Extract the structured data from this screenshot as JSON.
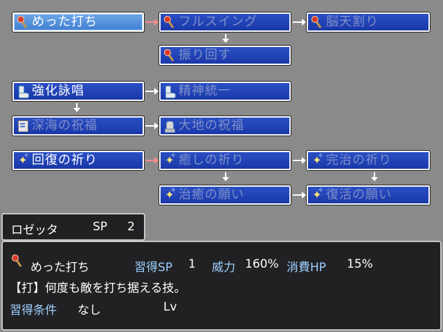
{
  "skill_tree": {
    "row1": [
      {
        "label": "めった打ち",
        "icon": "staff-icon",
        "state": "selected"
      },
      {
        "label": "フルスイング",
        "icon": "staff-icon",
        "state": "locked"
      },
      {
        "label": "脳天割り",
        "icon": "staff-icon",
        "state": "locked"
      }
    ],
    "row1b": [
      {
        "label": "振り回す",
        "icon": "staff-icon",
        "state": "locked"
      }
    ],
    "row2": [
      {
        "label": "強化詠唱",
        "icon": "boot-icon",
        "state": "learned"
      },
      {
        "label": "精神統一",
        "icon": "boot-icon",
        "state": "locked"
      }
    ],
    "row2b": [
      {
        "label": "深海の祝福",
        "icon": "scroll-icon",
        "state": "locked"
      },
      {
        "label": "大地の祝福",
        "icon": "glove-icon",
        "state": "locked"
      }
    ],
    "row3": [
      {
        "label": "回復の祈り",
        "icon": "sparkle-icon",
        "state": "learned"
      },
      {
        "label": "癒しの祈り",
        "icon": "sparkle-icon",
        "state": "locked"
      },
      {
        "label": "完治の祈り",
        "icon": "sparkle-icon",
        "state": "locked"
      }
    ],
    "row3b": [
      {
        "label": "治癒の願い",
        "icon": "sparkle-icon",
        "state": "locked"
      },
      {
        "label": "復活の願い",
        "icon": "sparkle-icon",
        "state": "locked"
      }
    ]
  },
  "character": {
    "name": "ロゼッタ",
    "sp_label": "SP",
    "sp_value": "2"
  },
  "detail": {
    "name": "めった打ち",
    "cost_label": "習得SP",
    "cost_value": "1",
    "power_label": "威力",
    "power_value": "160%",
    "hp_label": "消費HP",
    "hp_value": "15%",
    "description": "【打】何度も敵を打ち据える技。",
    "condition_label": "習得条件",
    "condition_value": "なし",
    "lv_label": "Lv"
  },
  "colors": {
    "node_blue": "#1a38a8",
    "selected_blue": "#3f7fd2",
    "locked_text": "#7f8fc9",
    "label_cyan": "#9ed0ff",
    "red_arrow": "#ff8c8c"
  }
}
